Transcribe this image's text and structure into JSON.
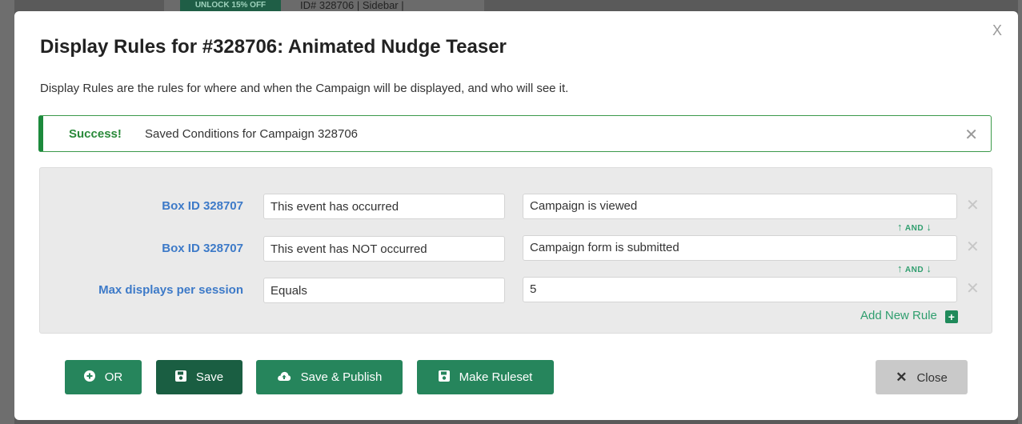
{
  "background": {
    "button_label": "UNLOCK 15% OFF",
    "info_text": "ID# 328706 | Sidebar |"
  },
  "modal": {
    "close_label": "X",
    "title": "Display Rules for #328706: Animated Nudge Teaser",
    "description": "Display Rules are the rules for where and when the Campaign will be displayed, and who will see it."
  },
  "alert": {
    "strong": "Success!",
    "message": "Saved Conditions for Campaign 328706",
    "close": "✕"
  },
  "rules": [
    {
      "label": "Box ID 328707",
      "condition": "This event has occurred",
      "value": "Campaign is viewed"
    },
    {
      "label": "Box ID 328707",
      "condition": "This event has NOT occurred",
      "value": "Campaign form is submitted"
    },
    {
      "label": "Max displays per session",
      "condition": "Equals",
      "value": "5"
    }
  ],
  "connector_label": "AND",
  "remove_glyph": "✕",
  "add_rule_label": "Add New Rule",
  "buttons": {
    "or": "OR",
    "save": "Save",
    "save_publish": "Save & Publish",
    "make_ruleset": "Make Ruleset",
    "close": "Close"
  },
  "colors": {
    "primary_green": "#26855c",
    "dark_green": "#1a5e42",
    "success_border": "#1c8a3c",
    "label_blue": "#3d7ac8"
  },
  "icons": [
    "plus-circle-icon",
    "floppy-disk-icon",
    "cloud-upload-icon",
    "close-icon",
    "arrow-up-icon",
    "arrow-down-icon",
    "plus-box-icon"
  ]
}
